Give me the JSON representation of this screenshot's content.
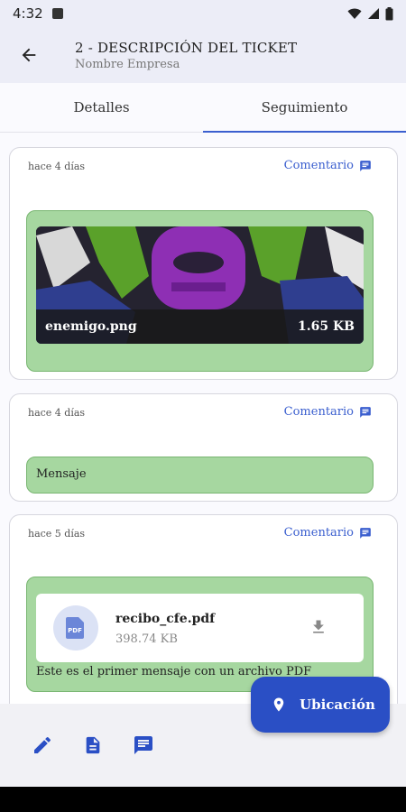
{
  "status": {
    "time": "4:32"
  },
  "header": {
    "title": "2 - DESCRIPCIÓN DEL TICKET",
    "subtitle": "Nombre Empresa"
  },
  "tabs": [
    {
      "label": "Detalles"
    },
    {
      "label": "Seguimiento"
    }
  ],
  "active_tab": "Seguimiento",
  "cards": [
    {
      "time": "hace 4 días",
      "comment_label": "Comentario",
      "attachment": {
        "type": "image",
        "name": "enemigo.png",
        "size": "1.65 KB"
      }
    },
    {
      "time": "hace 4 días",
      "comment_label": "Comentario",
      "message": "Mensaje"
    },
    {
      "time": "hace 5 días",
      "comment_label": "Comentario",
      "attachment": {
        "type": "pdf",
        "name": "recibo_cfe.pdf",
        "size": "398.74 KB",
        "icon_text": "PDF"
      },
      "message": "Este es el primer mensaje con un archivo PDF"
    }
  ],
  "fab": {
    "label": "Ubicación"
  },
  "colors": {
    "accent": "#3b5fcf",
    "bubble": "#a6d7a0",
    "fab": "#2a4fc5",
    "appbar": "#ecedf7"
  }
}
